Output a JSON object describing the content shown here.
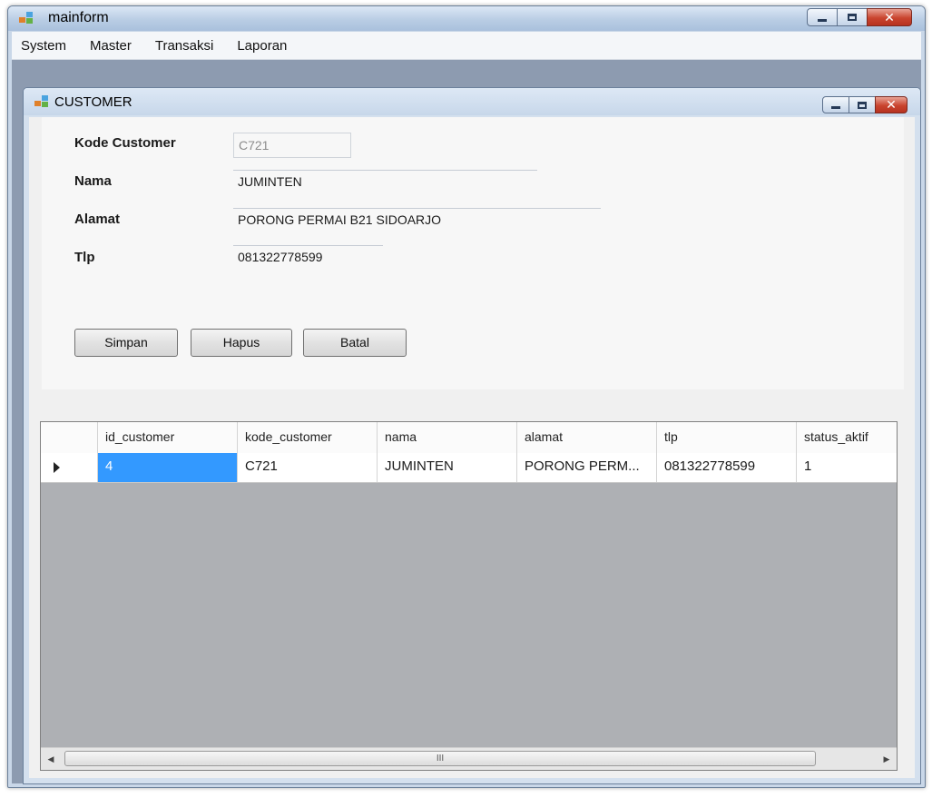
{
  "main_window": {
    "title": "mainform",
    "menu": [
      "System",
      "Master",
      "Transaksi",
      "Laporan"
    ]
  },
  "child_window": {
    "title": "CUSTOMER"
  },
  "form": {
    "kode_label": "Kode Customer",
    "kode_value": "C721",
    "nama_label": "Nama",
    "nama_value": "JUMINTEN",
    "alamat_label": "Alamat",
    "alamat_value": "PORONG PERMAI B21 SIDOARJO",
    "tlp_label": "Tlp",
    "tlp_value": "081322778599"
  },
  "buttons": {
    "simpan": "Simpan",
    "hapus": "Hapus",
    "batal": "Batal"
  },
  "grid": {
    "columns": [
      "id_customer",
      "kode_customer",
      "nama",
      "alamat",
      "tlp",
      "status_aktif"
    ],
    "rows": [
      [
        "4",
        "C721",
        "JUMINTEN",
        "PORONG PERM...",
        "081322778599",
        "1"
      ]
    ],
    "scroll_grip": "III"
  },
  "colors": {
    "selection": "#3399ff",
    "close_button": "#c9442e"
  }
}
